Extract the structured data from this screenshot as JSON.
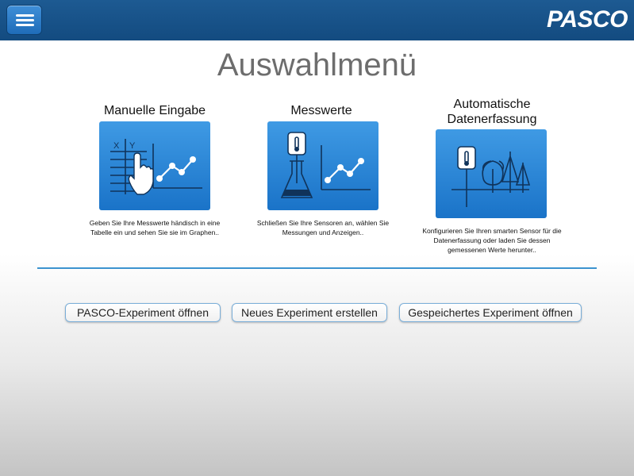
{
  "header": {
    "menu_icon": "hamburger-menu-icon",
    "logo_text": "PASCO",
    "bar_color": "#17518a"
  },
  "title": "Auswahlmenü",
  "cards": [
    {
      "title": "Manuelle Eingabe",
      "description": "Geben Sie Ihre Messwerte händisch in eine Tabelle ein und sehen Sie sie im Graphen..",
      "icon": "table-hand-graph-icon",
      "icon_labels": [
        "X",
        "Y"
      ]
    },
    {
      "title": "Messwerte",
      "description": "Schließen Sie Ihre Sensoren an, wählen Sie Messungen und Anzeigen..",
      "icon": "sensor-flask-graph-icon"
    },
    {
      "title_line1": "Automatische",
      "title_line2": "Datenerfassung",
      "description": "Konfigurieren Sie Ihren smarten Sensor für die Datenerfassung oder laden Sie dessen gemessenen Werte herunter..",
      "icon": "sensor-trees-icon"
    }
  ],
  "buttons": {
    "open_pasco": "PASCO-Experiment öffnen",
    "new_experiment": "Neues Experiment erstellen",
    "open_saved": "Gespeichertes Experiment öffnen"
  },
  "colors": {
    "accent": "#3c93cf",
    "card_blue": "#2a86d8",
    "title_gray": "#6d6d6d"
  }
}
